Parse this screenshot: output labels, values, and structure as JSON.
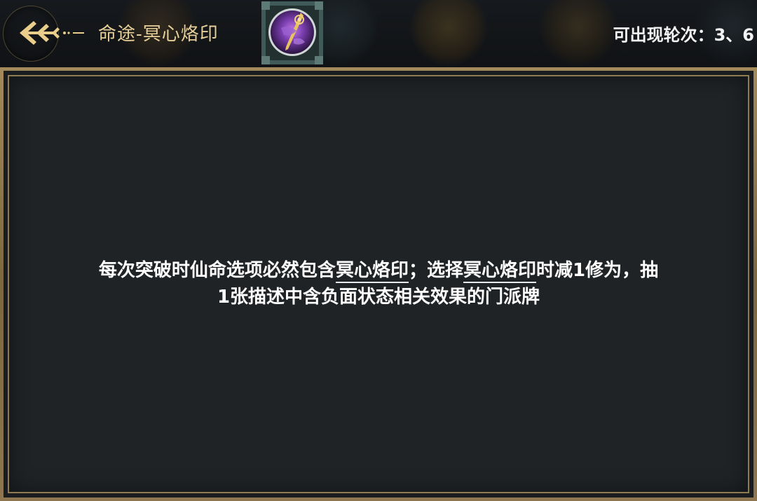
{
  "header": {
    "title": "命途-冥心烙印",
    "rounds_text": "可出现轮次：3、6",
    "back_icon": "back-arrow-icon",
    "destiny_icon": "mindseal-emblem-icon"
  },
  "description": {
    "line1": {
      "part1": "每次突破时仙命选项必然包含",
      "keyword1": "冥心烙印",
      "part2": "；选择",
      "keyword2": "冥心烙印",
      "part3": "时减1修为，抽"
    },
    "line2": "1张描述中含负面状态相关效果的门派牌"
  },
  "colors": {
    "title": "#e6cf98",
    "gold_frame": "#a48a5a",
    "panel_bg": "#1f2326",
    "text": "#ffffff",
    "emblem_purple": "#7b3fb0"
  }
}
